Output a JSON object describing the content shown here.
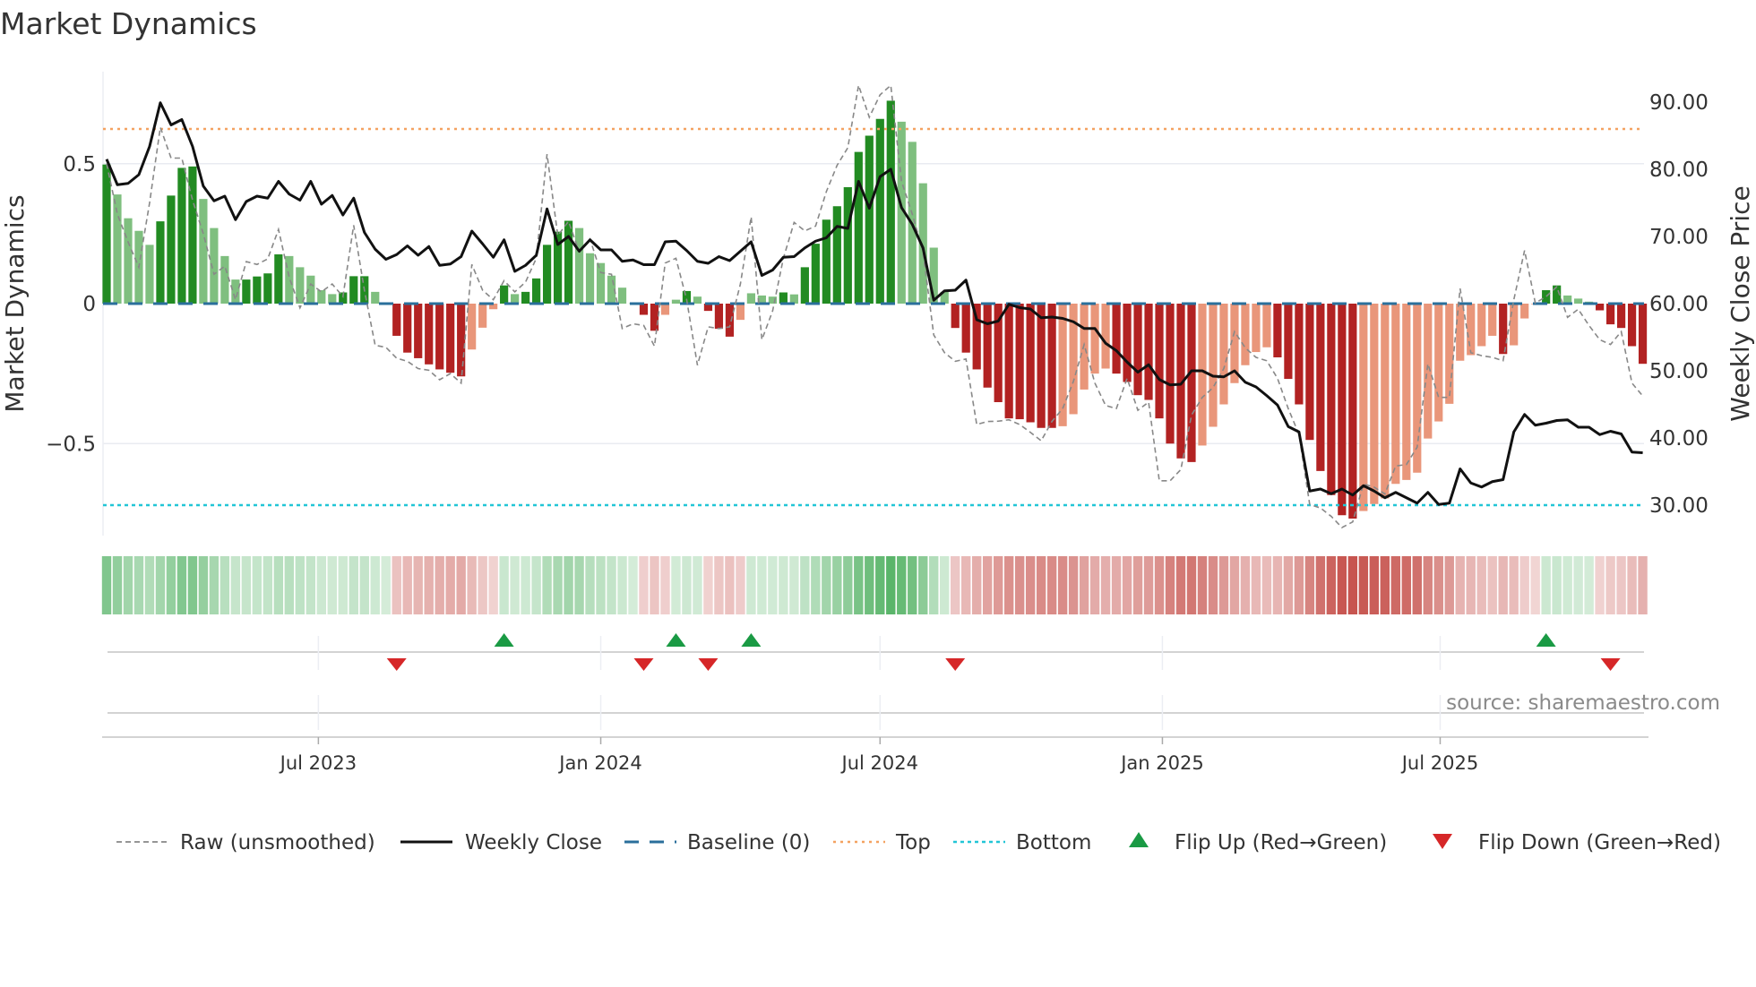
{
  "chart_data": {
    "type": "bar",
    "title": "Market Dynamics",
    "ylabel": "Market Dynamics",
    "y2label": "Weekly Close Price",
    "start_date": "2023-02-13",
    "frequency": "weekly",
    "ylim": [
      -0.83,
      0.86
    ],
    "y2lim": [
      25,
      95
    ],
    "yticks": [
      {
        "v": 0.5,
        "label": "0.5"
      },
      {
        "v": 0,
        "label": "0"
      },
      {
        "v": -0.5,
        "label": "−0.5"
      }
    ],
    "y2ticks": [
      {
        "v": 90,
        "label": "90.00"
      },
      {
        "v": 80,
        "label": "80.00"
      },
      {
        "v": 70,
        "label": "70.00"
      },
      {
        "v": 60,
        "label": "60.00"
      },
      {
        "v": 50,
        "label": "50.00"
      },
      {
        "v": 40,
        "label": "40.00"
      },
      {
        "v": 30,
        "label": "30.00"
      }
    ],
    "xticks": [
      {
        "date": "2023-07-01",
        "label": "Jul 2023"
      },
      {
        "date": "2024-01-01",
        "label": "Jan 2024"
      },
      {
        "date": "2024-07-01",
        "label": "Jul 2024"
      },
      {
        "date": "2025-01-01",
        "label": "Jan 2025"
      },
      {
        "date": "2025-07-01",
        "label": "Jul 2025"
      }
    ],
    "top_level": 0.624,
    "bottom_level": -0.72,
    "baseline": 0,
    "dynamics": [
      0.497,
      0.39,
      0.305,
      0.26,
      0.21,
      0.294,
      0.386,
      0.485,
      0.49,
      0.374,
      0.27,
      0.17,
      0.086,
      0.086,
      0.097,
      0.108,
      0.176,
      0.17,
      0.13,
      0.1,
      0.048,
      0.034,
      0.04,
      0.098,
      0.098,
      0.042,
      0.002,
      -0.115,
      -0.175,
      -0.195,
      -0.217,
      -0.235,
      -0.247,
      -0.26,
      -0.164,
      -0.086,
      -0.02,
      0.065,
      0.034,
      0.042,
      0.09,
      0.21,
      0.257,
      0.296,
      0.27,
      0.18,
      0.145,
      0.1,
      0.057,
      0.001,
      -0.04,
      -0.097,
      -0.04,
      0.014,
      0.045,
      0.025,
      -0.026,
      -0.09,
      -0.118,
      -0.058,
      0.037,
      0.029,
      0.025,
      0.04,
      0.033,
      0.13,
      0.214,
      0.3,
      0.348,
      0.416,
      0.542,
      0.6,
      0.66,
      0.725,
      0.65,
      0.578,
      0.43,
      0.2,
      0.042,
      -0.087,
      -0.175,
      -0.235,
      -0.3,
      -0.352,
      -0.41,
      -0.413,
      -0.424,
      -0.444,
      -0.444,
      -0.438,
      -0.395,
      -0.307,
      -0.25,
      -0.232,
      -0.25,
      -0.28,
      -0.327,
      -0.344,
      -0.41,
      -0.5,
      -0.553,
      -0.566,
      -0.507,
      -0.44,
      -0.36,
      -0.284,
      -0.22,
      -0.173,
      -0.156,
      -0.192,
      -0.269,
      -0.36,
      -0.487,
      -0.598,
      -0.684,
      -0.756,
      -0.768,
      -0.741,
      -0.716,
      -0.696,
      -0.644,
      -0.63,
      -0.604,
      -0.482,
      -0.421,
      -0.358,
      -0.204,
      -0.184,
      -0.152,
      -0.115,
      -0.18,
      -0.149,
      -0.053,
      -0.002,
      0.048,
      0.065,
      0.029,
      0.018,
      0.007,
      -0.024,
      -0.074,
      -0.087,
      -0.152,
      -0.215
    ],
    "raw": [
      0.5,
      0.32,
      0.22,
      0.13,
      0.36,
      0.63,
      0.52,
      0.52,
      0.37,
      0.25,
      0.105,
      0.134,
      0.014,
      0.15,
      0.14,
      0.16,
      0.265,
      0.094,
      -0.015,
      0.07,
      0.042,
      0.07,
      0.025,
      0.28,
      0.048,
      -0.149,
      -0.156,
      -0.195,
      -0.206,
      -0.232,
      -0.238,
      -0.272,
      -0.25,
      -0.284,
      0.14,
      0.048,
      0.014,
      0.082,
      0.042,
      0.077,
      0.162,
      0.534,
      0.243,
      0.294,
      0.185,
      0.231,
      0.111,
      0.105,
      -0.089,
      -0.072,
      -0.078,
      -0.152,
      0.145,
      0.162,
      0.014,
      -0.22,
      -0.083,
      -0.089,
      -0.083,
      0.07,
      0.31,
      -0.129,
      -0.026,
      0.162,
      0.29,
      0.26,
      0.277,
      0.4,
      0.494,
      0.557,
      0.78,
      0.666,
      0.746,
      0.78,
      0.437,
      0.32,
      0.185,
      -0.112,
      -0.175,
      -0.206,
      -0.198,
      -0.432,
      -0.421,
      -0.42,
      -0.415,
      -0.432,
      -0.46,
      -0.49,
      -0.421,
      -0.375,
      -0.278,
      -0.146,
      -0.284,
      -0.364,
      -0.375,
      -0.267,
      -0.381,
      -0.352,
      -0.633,
      -0.633,
      -0.593,
      -0.398,
      -0.335,
      -0.3,
      -0.232,
      -0.1,
      -0.158,
      -0.192,
      -0.204,
      -0.267,
      -0.375,
      -0.467,
      -0.718,
      -0.73,
      -0.76,
      -0.8,
      -0.78,
      -0.644,
      -0.656,
      -0.68,
      -0.58,
      -0.575,
      -0.513,
      -0.215,
      -0.335,
      -0.335,
      0.054,
      -0.175,
      -0.186,
      -0.192,
      -0.204,
      0.014,
      0.19,
      0.002,
      0.025,
      0.06,
      -0.049,
      -0.02,
      -0.078,
      -0.129,
      -0.146,
      -0.1,
      -0.284,
      -0.33
    ],
    "weekly_close": [
      81.5,
      77.7,
      77.9,
      79.2,
      83.4,
      89.9,
      86.6,
      87.4,
      83.4,
      77.5,
      75.3,
      76.0,
      72.5,
      75.2,
      76.0,
      75.7,
      78.2,
      76.3,
      75.4,
      78.2,
      74.8,
      76.1,
      73.2,
      75.7,
      70.6,
      68.1,
      66.6,
      67.3,
      68.6,
      67.2,
      68.5,
      65.7,
      65.9,
      67.0,
      70.8,
      68.9,
      66.9,
      69.5,
      64.8,
      65.7,
      67.2,
      74.1,
      68.8,
      70.0,
      67.8,
      69.5,
      68.0,
      68.0,
      66.3,
      66.5,
      65.8,
      65.8,
      69.2,
      69.3,
      67.9,
      66.3,
      66.0,
      67.0,
      66.4,
      67.8,
      69.2,
      64.2,
      65.0,
      66.9,
      67.0,
      68.3,
      69.3,
      69.8,
      71.5,
      71.2,
      78.2,
      74.2,
      78.9,
      80.0,
      74.3,
      71.8,
      68.3,
      60.5,
      61.9,
      62.0,
      63.5,
      57.6,
      57.0,
      57.4,
      59.9,
      59.4,
      59.2,
      57.9,
      58.0,
      57.8,
      57.3,
      56.3,
      56.3,
      54.1,
      53.0,
      51.3,
      49.8,
      50.9,
      48.7,
      47.9,
      48.0,
      50.0,
      50.0,
      49.2,
      49.1,
      50.0,
      48.3,
      47.6,
      46.3,
      44.9,
      41.7,
      40.9,
      32.1,
      32.4,
      31.7,
      32.4,
      31.5,
      32.9,
      32.1,
      31.1,
      31.9,
      31.1,
      30.3,
      31.9,
      30.1,
      30.3,
      35.4,
      33.3,
      32.7,
      33.5,
      33.8,
      40.9,
      43.5,
      41.9,
      42.2,
      42.6,
      42.7,
      41.6,
      41.6,
      40.5,
      41.0,
      40.6,
      37.9,
      37.8
    ],
    "flip_up_week_index": [
      37,
      53,
      60,
      134
    ],
    "flip_down_week_index": [
      27,
      50,
      56,
      79,
      140
    ],
    "colors": {
      "green_strong": "#228b22",
      "green_weak": "#7fbf7f",
      "red_strong": "#b22222",
      "red_weak": "#e9967a",
      "raw": "#888888",
      "close": "#111111",
      "baseline": "#2a6f9b",
      "top": "#f4a261",
      "bottom": "#22c5d6",
      "flip_up": "#1a9a44",
      "flip_down": "#d62728",
      "heat_green": "#3da850",
      "heat_red": "#c0403a"
    },
    "legend": {
      "position": "bottom",
      "items": [
        {
          "key": "raw",
          "label": "Raw (unsmoothed)"
        },
        {
          "key": "close",
          "label": "Weekly Close"
        },
        {
          "key": "baseline",
          "label": "Baseline (0)"
        },
        {
          "key": "top",
          "label": "Top"
        },
        {
          "key": "bottom",
          "label": "Bottom"
        },
        {
          "key": "flip_up",
          "label": "Flip Up (Red→Green)"
        },
        {
          "key": "flip_down",
          "label": "Flip Down (Green→Red)"
        }
      ]
    },
    "source": "source: sharemaestro.com"
  }
}
